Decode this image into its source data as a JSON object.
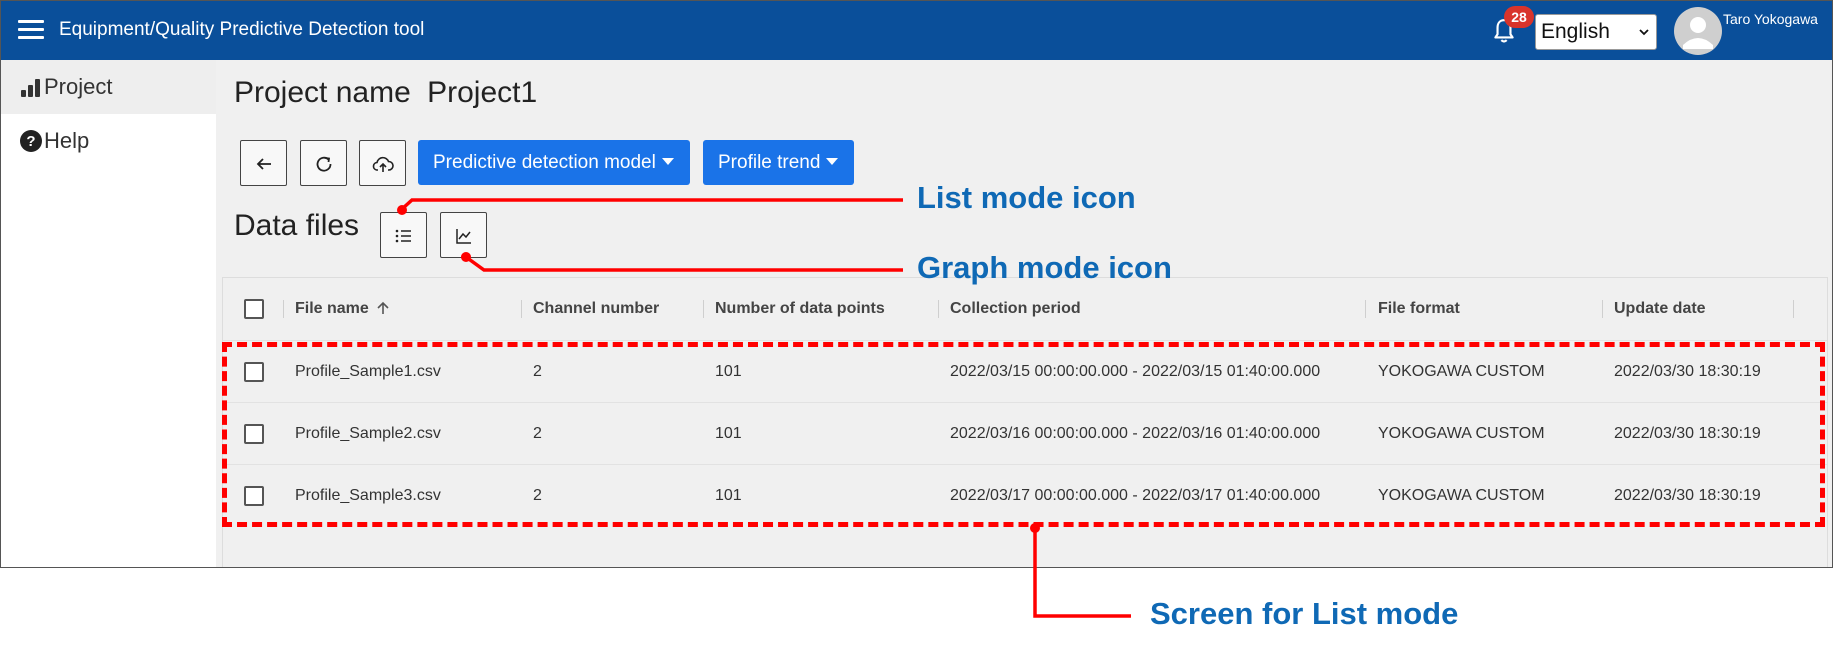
{
  "header": {
    "app_title": "Equipment/Quality Predictive Detection tool",
    "notification_count": "28",
    "language": "English",
    "user_name": "Taro Yokogawa",
    "bg_color": "#0a4f9a"
  },
  "sidebar": {
    "items": [
      {
        "label": "Project",
        "icon": "bar-chart-icon"
      },
      {
        "label": "Help",
        "icon": "help-icon"
      }
    ]
  },
  "main": {
    "project_label": "Project name",
    "project_name": "Project1",
    "toolbar": {
      "back_icon": "arrow-left-icon",
      "refresh_icon": "refresh-icon",
      "upload_icon": "cloud-upload-icon",
      "model_menu": "Predictive detection model",
      "trend_menu": "Profile trend",
      "accent": "#1a73e8"
    },
    "data_files_title": "Data files",
    "mode_icons": [
      "list-mode-icon",
      "graph-mode-icon"
    ]
  },
  "table": {
    "columns": [
      "File name",
      "Channel number",
      "Number of data points",
      "Collection period",
      "File format",
      "Update date"
    ],
    "rows": [
      [
        "Profile_Sample1.csv",
        "2",
        "101",
        "2022/03/15 00:00:00.000 - 2022/03/15 01:40:00.000",
        "YOKOGAWA CUSTOM",
        "2022/03/30 18:30:19"
      ],
      [
        "Profile_Sample2.csv",
        "2",
        "101",
        "2022/03/16 00:00:00.000 - 2022/03/16 01:40:00.000",
        "YOKOGAWA CUSTOM",
        "2022/03/30 18:30:19"
      ],
      [
        "Profile_Sample3.csv",
        "2",
        "101",
        "2022/03/17 00:00:00.000 - 2022/03/17 01:40:00.000",
        "YOKOGAWA CUSTOM",
        "2022/03/30 18:30:19"
      ]
    ]
  },
  "annotations": {
    "list_mode": "List mode icon",
    "graph_mode": "Graph mode icon",
    "list_screen": "Screen for List mode",
    "color": "#ff0000",
    "text_color": "#0f69b5"
  }
}
